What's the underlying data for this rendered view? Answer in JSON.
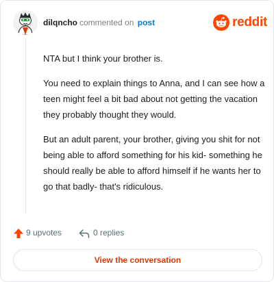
{
  "header": {
    "username": "dilqncho",
    "action_text": "commented on",
    "target_link": "post",
    "brand_name": "reddit"
  },
  "comment": {
    "paragraphs": [
      "NTA but I think your brother is.",
      "You need to explain things to Anna, and I can see how a teen might feel a bit bad about not getting the vacation they probably thought they would.",
      "But an adult parent, your brother, giving you shit for not being able to afford something for his kid- something he should really be able to afford himself if he wants her to go that badly- that's ridiculous."
    ]
  },
  "footer": {
    "upvotes_label": "9 upvotes",
    "replies_label": "0 replies"
  },
  "cta": {
    "label": "View the conversation"
  },
  "icons": {
    "upvote": "upvote-arrow-icon",
    "reply": "reply-arrow-icon",
    "brand": "reddit-snoo-icon"
  },
  "colors": {
    "brand_orange": "#ff4500",
    "upvote_orange": "#ff4500",
    "link_blue": "#0079d3",
    "cta_text": "#d93a00",
    "muted_text": "#576f76",
    "border": "#e3e5e8"
  }
}
